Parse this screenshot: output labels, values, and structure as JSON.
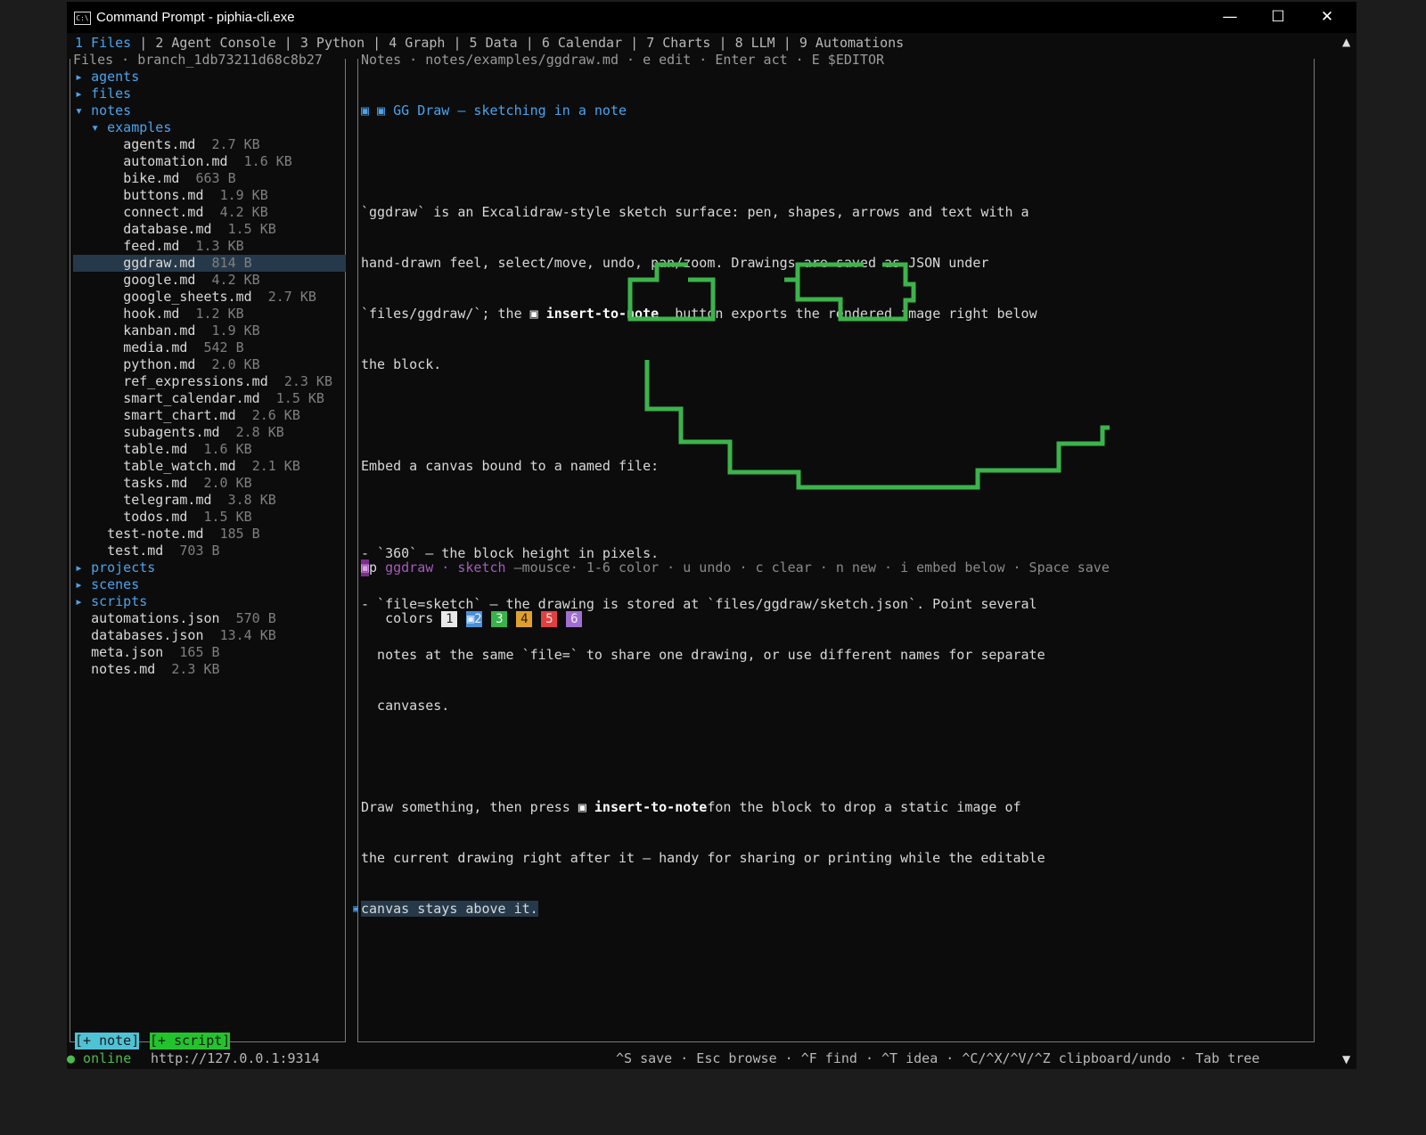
{
  "window": {
    "title": "Command Prompt - piphia-cli.exe",
    "icon_text": "C:\\",
    "minimize": "—",
    "maximize": "☐",
    "close": "✕"
  },
  "tabs": [
    {
      "label": "1 Files",
      "active": true
    },
    {
      "label": "2 Agent Console"
    },
    {
      "label": "3 Python"
    },
    {
      "label": "4 Graph"
    },
    {
      "label": "5 Data"
    },
    {
      "label": "6 Calendar"
    },
    {
      "label": "7 Charts"
    },
    {
      "label": "8 LLM"
    },
    {
      "label": "9 Automations"
    }
  ],
  "files_panel": {
    "title": "Files · branch_1db73211d68c8b27",
    "tree": [
      {
        "indent": 0,
        "name": "agents",
        "dir": true,
        "open": false
      },
      {
        "indent": 0,
        "name": "files",
        "dir": true,
        "open": false
      },
      {
        "indent": 0,
        "name": "notes",
        "dir": true,
        "open": true
      },
      {
        "indent": 1,
        "name": "examples",
        "dir": true,
        "open": true
      },
      {
        "indent": 2,
        "name": "agents.md",
        "size": "2.7 KB"
      },
      {
        "indent": 2,
        "name": "automation.md",
        "size": "1.6 KB"
      },
      {
        "indent": 2,
        "name": "bike.md",
        "size": "663 B"
      },
      {
        "indent": 2,
        "name": "buttons.md",
        "size": "1.9 KB"
      },
      {
        "indent": 2,
        "name": "connect.md",
        "size": "4.2 KB"
      },
      {
        "indent": 2,
        "name": "database.md",
        "size": "1.5 KB"
      },
      {
        "indent": 2,
        "name": "feed.md",
        "size": "1.3 KB"
      },
      {
        "indent": 2,
        "name": "ggdraw.md",
        "size": "814 B",
        "selected": true
      },
      {
        "indent": 2,
        "name": "google.md",
        "size": "4.2 KB"
      },
      {
        "indent": 2,
        "name": "google_sheets.md",
        "size": "2.7 KB"
      },
      {
        "indent": 2,
        "name": "hook.md",
        "size": "1.2 KB"
      },
      {
        "indent": 2,
        "name": "kanban.md",
        "size": "1.9 KB"
      },
      {
        "indent": 2,
        "name": "media.md",
        "size": "542 B"
      },
      {
        "indent": 2,
        "name": "python.md",
        "size": "2.0 KB"
      },
      {
        "indent": 2,
        "name": "ref_expressions.md",
        "size": "2.3 KB"
      },
      {
        "indent": 2,
        "name": "smart_calendar.md",
        "size": "1.5 KB"
      },
      {
        "indent": 2,
        "name": "smart_chart.md",
        "size": "2.6 KB"
      },
      {
        "indent": 2,
        "name": "subagents.md",
        "size": "2.8 KB"
      },
      {
        "indent": 2,
        "name": "table.md",
        "size": "1.6 KB"
      },
      {
        "indent": 2,
        "name": "table_watch.md",
        "size": "2.1 KB"
      },
      {
        "indent": 2,
        "name": "tasks.md",
        "size": "2.0 KB"
      },
      {
        "indent": 2,
        "name": "telegram.md",
        "size": "3.8 KB"
      },
      {
        "indent": 2,
        "name": "todos.md",
        "size": "1.5 KB"
      },
      {
        "indent": 1,
        "name": "test-note.md",
        "size": "185 B"
      },
      {
        "indent": 1,
        "name": "test.md",
        "size": "703 B"
      },
      {
        "indent": 0,
        "name": "projects",
        "dir": true,
        "open": false
      },
      {
        "indent": 0,
        "name": "scenes",
        "dir": true,
        "open": false
      },
      {
        "indent": 0,
        "name": "scripts",
        "dir": true,
        "open": false
      },
      {
        "indent": 0,
        "name": "automations.json",
        "size": "570 B"
      },
      {
        "indent": 0,
        "name": "databases.json",
        "size": "13.4 KB"
      },
      {
        "indent": 0,
        "name": "meta.json",
        "size": "165 B"
      },
      {
        "indent": 0,
        "name": "notes.md",
        "size": "2.3 KB"
      }
    ]
  },
  "notes_panel": {
    "title": "Notes · notes/examples/ggdraw.md · e edit · Enter act · E $EDITOR",
    "heading_prefix": "▣ ▣ ",
    "heading": "GG Draw — sketching in a note",
    "para1": [
      "`ggdraw` is an Excalidraw-style sketch surface: pen, shapes, arrows and text with a",
      "hand-drawn feel, select/move, undo, pan/zoom. Drawings are saved as JSON under"
    ],
    "para1_line3_a": "`files/ggdraw/`; the ",
    "para1_line3_icon": "▣ ",
    "para1_line3_bold": "insert-to-note",
    "para1_line3_b": "  button exports the rendered image right below",
    "para1_line4": "the block.",
    "embed_line": "Embed a canvas bound to a named file:",
    "toolbar": {
      "tag": "▣",
      "p": "p",
      "name": "ggdraw",
      "dot": " · ",
      "file": "sketch",
      "rest": " —mousce· 1-6 color · u undo · c clear · n new · i embed below · Space save"
    },
    "colors_label": "colors",
    "colors": [
      {
        "label": "1",
        "bg": "#e8e8e8",
        "fg": "#222222"
      },
      {
        "label": "▣2",
        "bg": "#4a90d9",
        "fg": "#e8f0ff"
      },
      {
        "label": "3",
        "bg": "#38b24a",
        "fg": "#e8ffe8"
      },
      {
        "label": "4",
        "bg": "#e0a030",
        "fg": "#2a1a00"
      },
      {
        "label": "5",
        "bg": "#e04040",
        "fg": "#ffe8e8"
      },
      {
        "label": "6",
        "bg": "#a070d0",
        "fg": "#f4e8ff"
      }
    ],
    "sketch_color": "#3cb44b",
    "bullets": [
      "- `360` — the block height in pixels.",
      "- `file=sketch` — the drawing is stored at `files/ggdraw/sketch.json`. Point several",
      "  notes at the same `file=` to share one drawing, or use different names for separate",
      "  canvases."
    ],
    "para3_a": "Draw something, then press ",
    "para3_icon": "▣ ",
    "para3_bold": "insert-to-note",
    "para3_b": "fon the block to drop a static image of",
    "para3_line2": "the current drawing right after it — handy for sharing or printing while the editable",
    "para3_line3": "canvas stays above it.",
    "cursor_glyph": "▣"
  },
  "buttons": {
    "note": "[+ note]",
    "script": "[+ script]"
  },
  "status": {
    "online": "● online",
    "url": "http://127.0.0.1:9314",
    "keys": "^S save · Esc browse · ^F find · ^T idea · ^C/^X/^V/^Z clipboard/undo · Tab tree"
  },
  "scrollbar": {
    "up": "▲",
    "down": "▼"
  }
}
